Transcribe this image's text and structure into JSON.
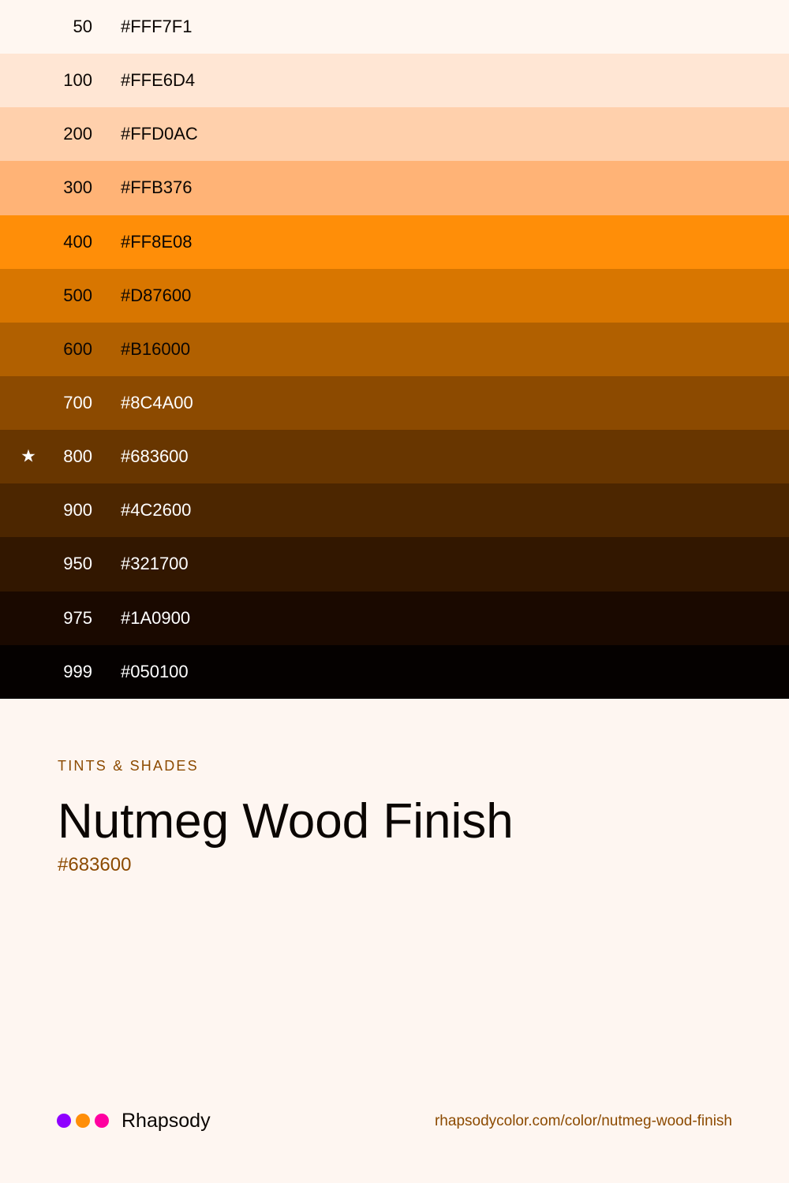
{
  "swatches": [
    {
      "step": "50",
      "hex": "#FFF7F1",
      "text_color": "#0B0603",
      "starred": false
    },
    {
      "step": "100",
      "hex": "#FFE6D4",
      "text_color": "#0B0603",
      "starred": false
    },
    {
      "step": "200",
      "hex": "#FFD0AC",
      "text_color": "#0B0603",
      "starred": false
    },
    {
      "step": "300",
      "hex": "#FFB376",
      "text_color": "#0B0603",
      "starred": false
    },
    {
      "step": "400",
      "hex": "#FF8E08",
      "text_color": "#0B0603",
      "starred": false
    },
    {
      "step": "500",
      "hex": "#D87600",
      "text_color": "#0B0603",
      "starred": false
    },
    {
      "step": "600",
      "hex": "#B16000",
      "text_color": "#0B0603",
      "starred": false
    },
    {
      "step": "700",
      "hex": "#8C4A00",
      "text_color": "#FFFFFF",
      "starred": false
    },
    {
      "step": "800",
      "hex": "#683600",
      "text_color": "#FFFFFF",
      "starred": true,
      "star": "★"
    },
    {
      "step": "900",
      "hex": "#4C2600",
      "text_color": "#FFFFFF",
      "starred": false
    },
    {
      "step": "950",
      "hex": "#321700",
      "text_color": "#FFFFFF",
      "starred": false
    },
    {
      "step": "975",
      "hex": "#1A0900",
      "text_color": "#FFFFFF",
      "starred": false
    },
    {
      "step": "999",
      "hex": "#050100",
      "text_color": "#FFFFFF",
      "starred": false
    }
  ],
  "info": {
    "eyebrow": "TINTS & SHADES",
    "title": "Nutmeg Wood Finish",
    "hex": "#683600"
  },
  "footer": {
    "brand": "Rhapsody",
    "dots": [
      "#8F00FF",
      "#FF8E08",
      "#FF00A0"
    ],
    "url": "rhapsodycolor.com/color/nutmeg-wood-finish"
  },
  "colors": {
    "page_background": "#FEF6F1",
    "accent": "#8C4A00",
    "text_dark": "#0B0603"
  }
}
